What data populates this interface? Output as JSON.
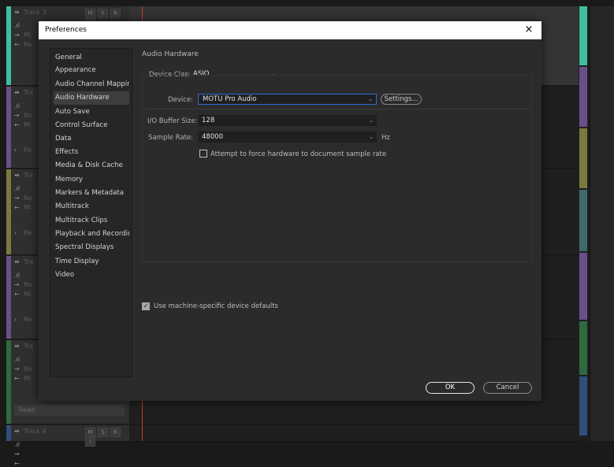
{
  "background": {
    "tracks": [
      {
        "name": "Track 3",
        "color": "#3fbf9f",
        "s1": "Mi",
        "s2": "Re",
        "s3": "",
        "read": ""
      },
      {
        "name": "Tra",
        "color": "#6a4f8a",
        "s1": "No",
        "s2": "Mi",
        "s3": "Re",
        "read": ""
      },
      {
        "name": "Tra",
        "color": "#7a7a3e",
        "s1": "No",
        "s2": "Mi",
        "s3": "Re",
        "read": ""
      },
      {
        "name": "Tra",
        "color": "#6a4f8a",
        "s1": "No",
        "s2": "Mi",
        "s3": "Re",
        "read": ""
      },
      {
        "name": "Tra",
        "color": "#2f6a3e",
        "s1": "No",
        "s2": "Mi",
        "s3": "",
        "read": "Read"
      },
      {
        "name": "Track 4",
        "color": "#2f4f7a",
        "s1": "",
        "s2": "",
        "s3": "",
        "read": ""
      }
    ],
    "track_buttons": [
      "M",
      "S",
      "R",
      "I"
    ],
    "right_strip_colors": [
      "#3fbf9f",
      "#6a4f8a",
      "#7a7a3e",
      "#3e6a6a",
      "#6a4f8a",
      "#2f6a3e",
      "#2f4f7a"
    ]
  },
  "dialog": {
    "title": "Preferences",
    "close_glyph": "×",
    "nav": [
      {
        "label": "General",
        "active": false
      },
      {
        "label": "Appearance",
        "active": false
      },
      {
        "label": "Audio Channel Mapping",
        "active": false
      },
      {
        "label": "Audio Hardware",
        "active": true
      },
      {
        "label": "Auto Save",
        "active": false
      },
      {
        "label": "Control Surface",
        "active": false
      },
      {
        "label": "Data",
        "active": false
      },
      {
        "label": "Effects",
        "active": false
      },
      {
        "label": "Media & Disk Cache",
        "active": false
      },
      {
        "label": "Memory",
        "active": false
      },
      {
        "label": "Markers & Metadata",
        "active": false
      },
      {
        "label": "Multitrack",
        "active": false
      },
      {
        "label": "Multitrack Clips",
        "active": false
      },
      {
        "label": "Playback and Recording",
        "active": false
      },
      {
        "label": "Spectral Displays",
        "active": false
      },
      {
        "label": "Time Display",
        "active": false
      },
      {
        "label": "Video",
        "active": false
      }
    ],
    "section_title": "Audio Hardware",
    "device_class": {
      "label": "Device Class:",
      "value": "ASIO"
    },
    "device": {
      "label": "Device:",
      "value": "MOTU Pro Audio",
      "settings_button": "Settings..."
    },
    "buffer": {
      "label": "I/O Buffer Size:",
      "value": "128"
    },
    "sample_rate": {
      "label": "Sample Rate:",
      "value": "48000",
      "unit": "Hz"
    },
    "force_rate": {
      "label": "Attempt to force hardware to document sample rate",
      "checked": false
    },
    "machine_defaults": {
      "label": "Use machine-specific device defaults",
      "checked": true
    },
    "ok_button": "OK",
    "cancel_button": "Cancel",
    "chevron_glyph": "⌄"
  }
}
